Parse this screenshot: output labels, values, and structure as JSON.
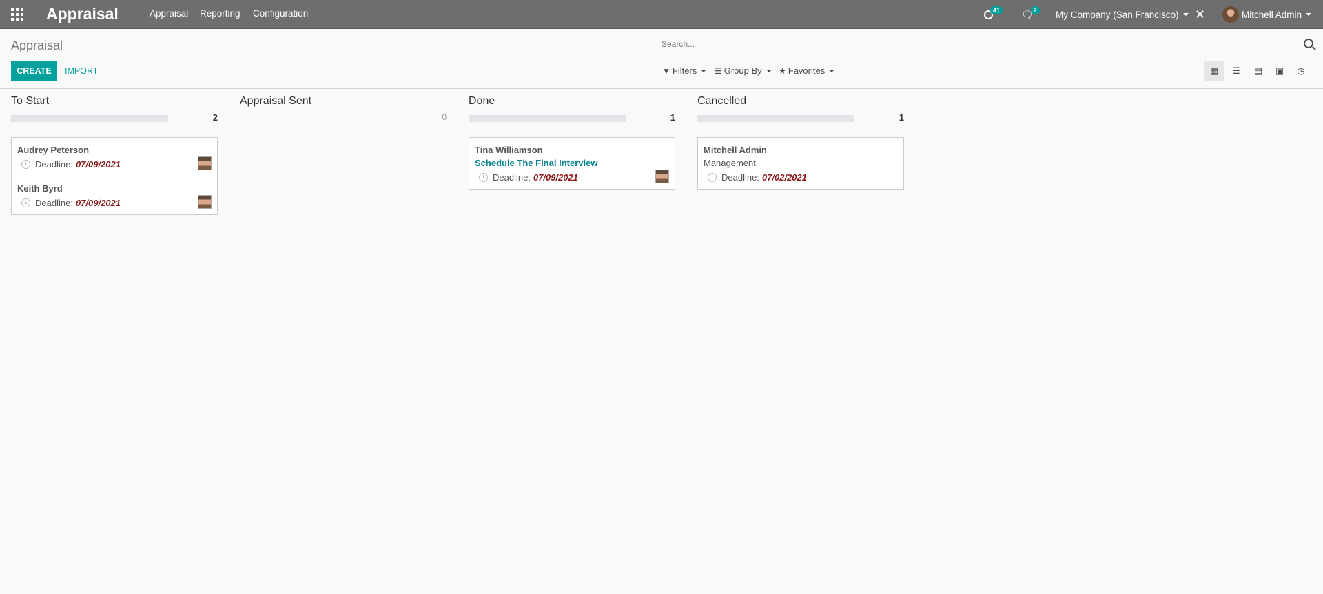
{
  "navbar": {
    "brand": "Appraisal",
    "menu": [
      "Appraisal",
      "Reporting",
      "Configuration"
    ],
    "activity_count": "41",
    "message_count": "2",
    "company": "My Company (San Francisco)",
    "user": "Mitchell Admin"
  },
  "control_panel": {
    "title": "Appraisal",
    "create_label": "CREATE",
    "import_label": "IMPORT",
    "search_placeholder": "Search...",
    "filters_label": "Filters",
    "group_by_label": "Group By",
    "favorites_label": "Favorites",
    "active_view": "kanban"
  },
  "kanban": {
    "columns": [
      {
        "title": "To Start",
        "count": "2",
        "cards": [
          {
            "name": "Audrey Peterson",
            "deadline_label": "Deadline:",
            "deadline": "07/09/2021"
          },
          {
            "name": "Keith Byrd",
            "deadline_label": "Deadline:",
            "deadline": "07/09/2021"
          }
        ]
      },
      {
        "title": "Appraisal Sent",
        "count": "0",
        "cards": []
      },
      {
        "title": "Done",
        "count": "1",
        "cards": [
          {
            "name": "Tina Williamson",
            "activity": "Schedule The Final Interview",
            "deadline_label": "Deadline:",
            "deadline": "07/09/2021"
          }
        ]
      },
      {
        "title": "Cancelled",
        "count": "1",
        "cards": [
          {
            "name": "Mitchell Admin",
            "department": "Management",
            "deadline_label": "Deadline:",
            "deadline": "07/02/2021"
          }
        ]
      }
    ]
  },
  "colors": {
    "navbar": "#6e6e6e",
    "accent": "#00a09d",
    "deadline": "#8b1c1c",
    "link": "#00838f"
  }
}
